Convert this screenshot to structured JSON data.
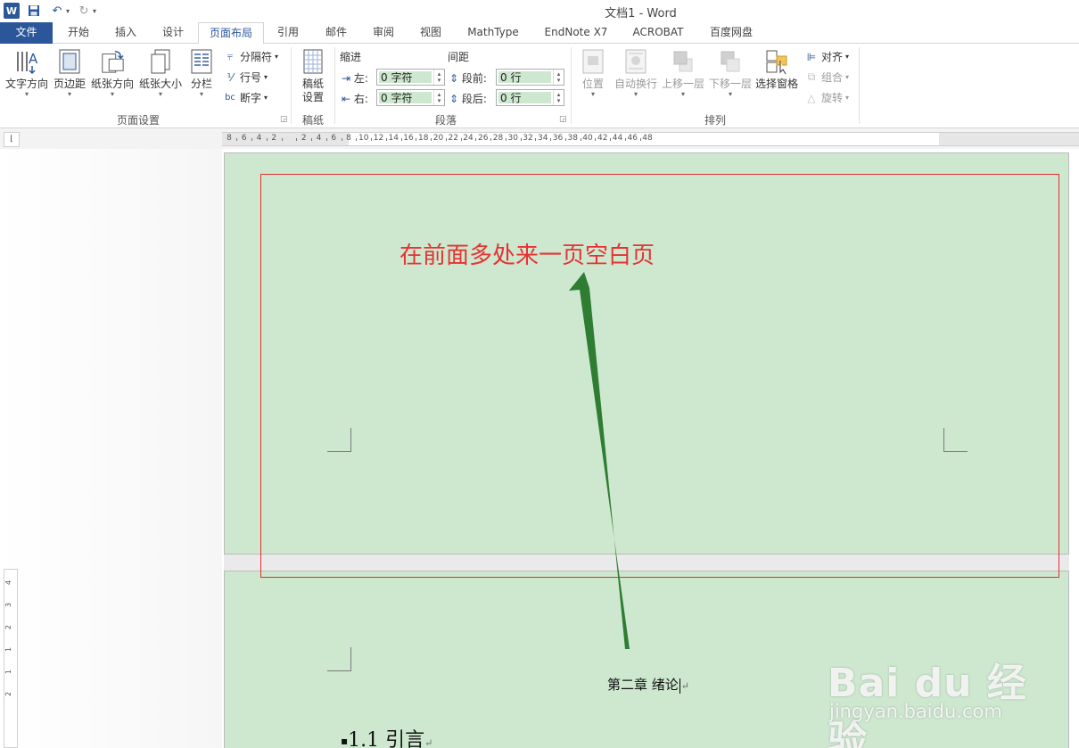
{
  "window": {
    "title": "文档1 - Word"
  },
  "tabs": [
    {
      "label": "文件"
    },
    {
      "label": "开始"
    },
    {
      "label": "插入"
    },
    {
      "label": "设计"
    },
    {
      "label": "页面布局"
    },
    {
      "label": "引用"
    },
    {
      "label": "邮件"
    },
    {
      "label": "审阅"
    },
    {
      "label": "视图"
    },
    {
      "label": "MathType"
    },
    {
      "label": "EndNote X7"
    },
    {
      "label": "ACROBAT"
    },
    {
      "label": "百度网盘"
    }
  ],
  "ribbon": {
    "page_setup": {
      "label": "页面设置",
      "text_direction": "文字方向",
      "margins": "页边距",
      "orientation": "纸张方向",
      "size": "纸张大小",
      "columns": "分栏",
      "breaks": "分隔符",
      "line_numbers": "行号",
      "hyphenation": "断字"
    },
    "manuscript": {
      "label": "稿纸",
      "settings_line1": "稿纸",
      "settings_line2": "设置"
    },
    "paragraph": {
      "label": "段落",
      "indent_header": "缩进",
      "spacing_header": "间距",
      "indent_left_label": "左:",
      "indent_left_value": "0 字符",
      "indent_right_label": "右:",
      "indent_right_value": "0 字符",
      "spacing_before_label": "段前:",
      "spacing_before_value": "0 行",
      "spacing_after_label": "段后:",
      "spacing_after_value": "0 行"
    },
    "arrange": {
      "label": "排列",
      "position": "位置",
      "wrap_text": "自动换行",
      "bring_forward": "上移一层",
      "send_backward": "下移一层",
      "selection_pane": "选择窗格",
      "align": "对齐",
      "group": "组合",
      "rotate": "旋转"
    }
  },
  "ruler": {
    "labels": [
      "8",
      "6",
      "4",
      "2",
      "",
      "2",
      "4",
      "6",
      "8",
      "10",
      "12",
      "14",
      "16",
      "18",
      "20",
      "22",
      "24",
      "26",
      "28",
      "30",
      "32",
      "34",
      "36",
      "38",
      "40",
      "42",
      "44",
      "46",
      "48"
    ],
    "vertical_labels": [
      "4",
      "3",
      "2",
      "1",
      "1",
      "2"
    ]
  },
  "document": {
    "annotation": "在前面多处来一页空白页",
    "chapter_heading": "第二章 绪论",
    "section_heading": "1.1 引言",
    "paragraph_mark": "↵"
  },
  "watermark": {
    "brand": "Bai du 经验",
    "url": "jingyan.baidu.com"
  },
  "colors": {
    "accent": "#2b579a",
    "page_bg": "#cde8cf",
    "annotation_red": "#e53333",
    "arrow_green": "#2e7d32"
  }
}
